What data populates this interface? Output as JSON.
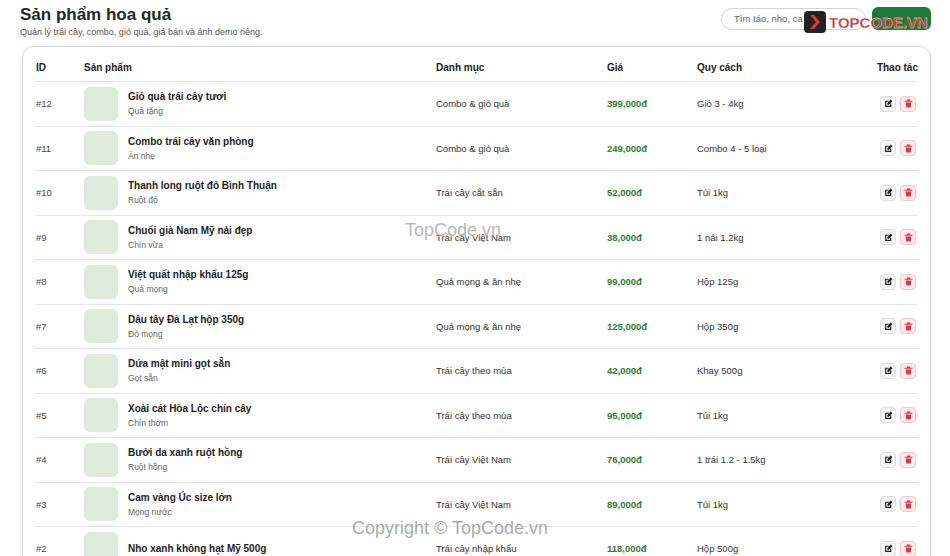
{
  "page": {
    "title": "Sản phẩm hoa quả",
    "subtitle": "Quản lý trái cây, combo, giỏ quà, giá bán và ảnh demo riêng."
  },
  "search": {
    "placeholder": "Tìm táo, nho, ca"
  },
  "table": {
    "columns": [
      "ID",
      "Sản phẩm",
      "Danh mục",
      "Giá",
      "Quy cách",
      "Thao tác"
    ],
    "rows": [
      {
        "id": "#12",
        "name": "Giỏ quà trái cây tươi",
        "note": "Quà tặng",
        "category": "Combo & giỏ quà",
        "price": "399,000đ",
        "spec": "Giỏ 3 - 4kg"
      },
      {
        "id": "#11",
        "name": "Combo trái cây văn phòng",
        "note": "Ăn nhẹ",
        "category": "Combo & giỏ quà",
        "price": "249,000đ",
        "spec": "Combo 4 - 5 loại"
      },
      {
        "id": "#10",
        "name": "Thanh long ruột đỏ Bình Thuận",
        "note": "Ruột đỏ",
        "category": "Trái cây cắt sẵn",
        "price": "52,000đ",
        "spec": "Túi 1kg"
      },
      {
        "id": "#9",
        "name": "Chuối già Nam Mỹ nải đẹp",
        "note": "Chín vừa",
        "category": "Trái cây Việt Nam",
        "price": "38,000đ",
        "spec": "1 nải 1.2kg"
      },
      {
        "id": "#8",
        "name": "Việt quất nhập khẩu 125g",
        "note": "Quả mọng",
        "category": "Quả mọng & ăn nhẹ",
        "price": "99,000đ",
        "spec": "Hộp 125g"
      },
      {
        "id": "#7",
        "name": "Dâu tây Đà Lạt hộp 350g",
        "note": "Đỏ mọng",
        "category": "Quả mọng & ăn nhẹ",
        "price": "125,000đ",
        "spec": "Hộp 350g"
      },
      {
        "id": "#6",
        "name": "Dứa mật mini gọt sẵn",
        "note": "Gọt sẵn",
        "category": "Trái cây theo mùa",
        "price": "42,000đ",
        "spec": "Khay 500g"
      },
      {
        "id": "#5",
        "name": "Xoài cát Hòa Lộc chín cây",
        "note": "Chín thơm",
        "category": "Trái cây theo mùa",
        "price": "95,000đ",
        "spec": "Túi 1kg"
      },
      {
        "id": "#4",
        "name": "Bưởi da xanh ruột hồng",
        "note": "Ruột hồng",
        "category": "Trái cây Việt Nam",
        "price": "76,000đ",
        "spec": "1 trái 1.2 - 1.5kg"
      },
      {
        "id": "#3",
        "name": "Cam vàng Úc size lớn",
        "note": "Mọng nước",
        "category": "Trái cây Việt Nam",
        "price": "89,000đ",
        "spec": "Túi 1kg"
      },
      {
        "id": "#2",
        "name": "Nho xanh không hạt Mỹ 500g",
        "note": "",
        "category": "Trái cây nhập khẩu",
        "price": "118,000đ",
        "spec": "Hộp 500g"
      }
    ]
  },
  "watermarks": {
    "logo": "TOPCODE.VN",
    "center": "TopCode.vn",
    "footer": "Copyright © TopCode.vn"
  }
}
